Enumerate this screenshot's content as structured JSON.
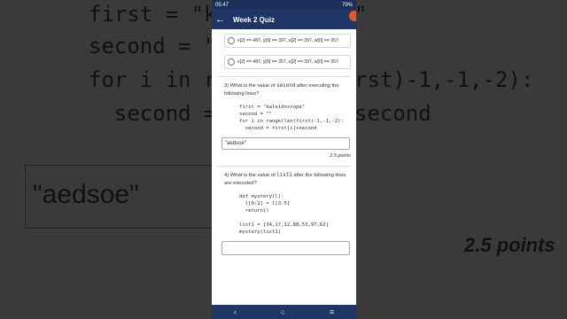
{
  "background": {
    "code_lines": [
      "first = \"ka",
      "\"",
      "second = \"",
      "for i in ra",
      "rst)-1,-1,-2):",
      "  second = ",
      "second"
    ],
    "answer": "\"aedsoe\"",
    "points": "2.5 points"
  },
  "status": {
    "time": "05:47",
    "battery": "79%"
  },
  "appbar": {
    "title": "Week 2 Quiz"
  },
  "options": [
    "x[2] == 487, y[0] == 397, u[2] == 397, w[0] == 357",
    "x[2] == 487, y[0] == 357, u[2] == 397, w[0] == 357"
  ],
  "q3": {
    "prefix": "3)  What is the value of ",
    "var": "second",
    "suffix": " after executing the following lines?",
    "code": "first = \"kaleidoscope\"\nsecond = \"\"\nfor i in range(len(first)-1,-1,-2):\n  second = first[i]+second",
    "answer": "\"aedsoe\"",
    "points": "2.5 points"
  },
  "q4": {
    "prefix": "4)  What is the value of ",
    "var": "list1",
    "suffix": " after the following lines are executed?",
    "code": "def mystery(l):\n  l[0:2] = l[3:5]\n  return()\n\nlist1 = [34,17,12,88,53,97,62]\nmystery(list1)"
  },
  "nav": {
    "back": "‹",
    "home": "○",
    "recents": "≡"
  }
}
